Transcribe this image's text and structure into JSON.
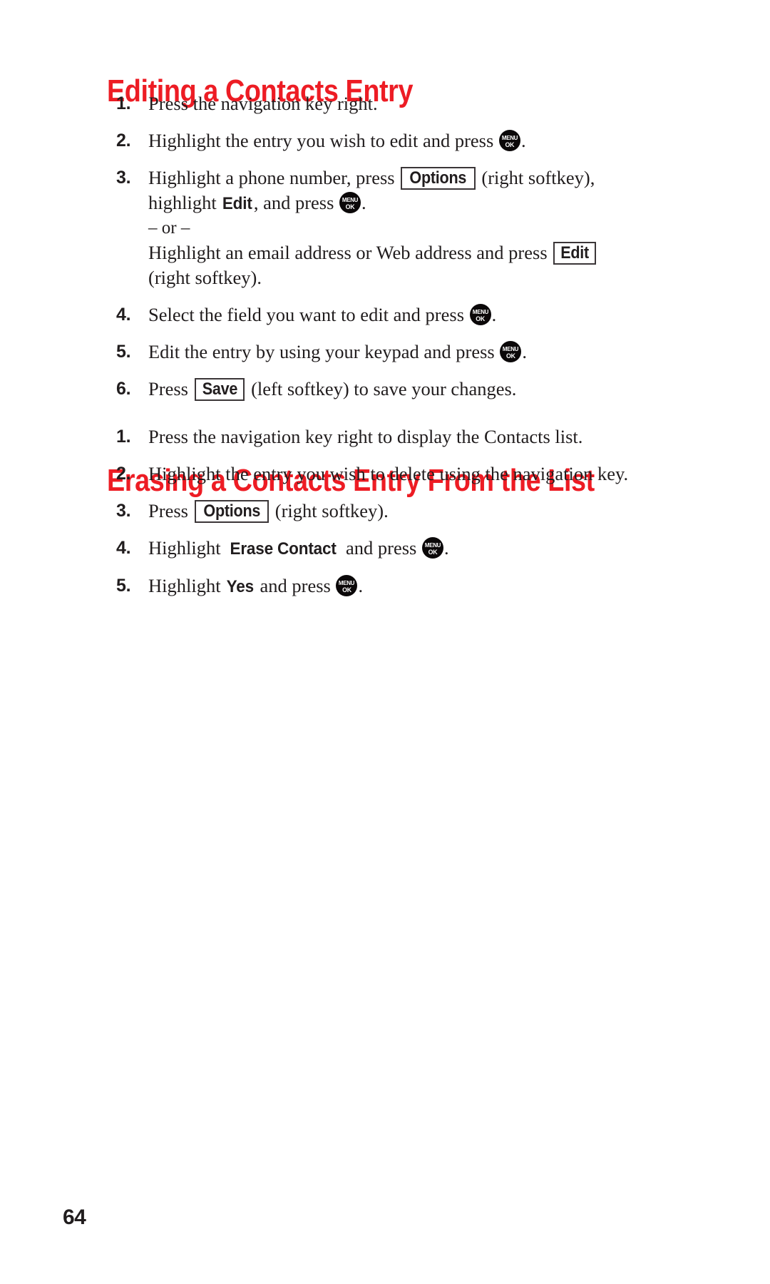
{
  "document": {
    "page_number": "64",
    "heading_color": "#ED1C24",
    "text_color": "#211D1E"
  },
  "icons": {
    "menu_ok": {
      "top": "MENU",
      "bottom": "OK",
      "name": "menu-ok-key-icon"
    }
  },
  "sections": [
    {
      "id": "editing-a-contacts-entry",
      "heading": "Editing a Contacts Entry",
      "steps": [
        {
          "number": "1.",
          "lines": [
            {
              "parts": [
                {
                  "type": "text",
                  "value": "Press the navigation key right."
                }
              ]
            }
          ]
        },
        {
          "number": "2.",
          "lines": [
            {
              "parts": [
                {
                  "type": "text",
                  "value": "Highlight the entry you wish to edit and press "
                },
                {
                  "type": "menukey"
                },
                {
                  "type": "text",
                  "value": "."
                }
              ]
            }
          ]
        },
        {
          "number": "3.",
          "lines": [
            {
              "parts": [
                {
                  "type": "text",
                  "value": "Highlight a phone number, press "
                },
                {
                  "type": "softkey",
                  "value": "Options"
                },
                {
                  "type": "text",
                  "value": " (right softkey),"
                }
              ]
            },
            {
              "parts": [
                {
                  "type": "text",
                  "value": "highlight "
                },
                {
                  "type": "term",
                  "value": "Edit"
                },
                {
                  "type": "text",
                  "value": ", and press "
                },
                {
                  "type": "menukey"
                },
                {
                  "type": "text",
                  "value": "."
                }
              ]
            },
            {
              "parts": [
                {
                  "type": "text",
                  "value": "– or –"
                }
              ]
            },
            {
              "parts": [
                {
                  "type": "text",
                  "value": "Highlight an email address or Web address and press "
                },
                {
                  "type": "softkey",
                  "value": "Edit"
                }
              ]
            },
            {
              "parts": [
                {
                  "type": "text",
                  "value": "(right softkey)."
                }
              ]
            }
          ]
        },
        {
          "number": "4.",
          "lines": [
            {
              "parts": [
                {
                  "type": "text",
                  "value": "Select the field you want to edit and press "
                },
                {
                  "type": "menukey"
                },
                {
                  "type": "text",
                  "value": "."
                }
              ]
            }
          ]
        },
        {
          "number": "5.",
          "lines": [
            {
              "parts": [
                {
                  "type": "text",
                  "value": "Edit the entry by using your keypad and press "
                },
                {
                  "type": "menukey"
                },
                {
                  "type": "text",
                  "value": "."
                }
              ]
            }
          ]
        },
        {
          "number": "6.",
          "lines": [
            {
              "parts": [
                {
                  "type": "text",
                  "value": "Press "
                },
                {
                  "type": "softkey",
                  "value": "Save"
                },
                {
                  "type": "text",
                  "value": " (left softkey) to save your changes."
                }
              ]
            }
          ]
        }
      ]
    },
    {
      "id": "erasing-a-contacts-entry-from-the-list",
      "heading": "Erasing a Contacts Entry From the List",
      "steps": [
        {
          "number": "1.",
          "lines": [
            {
              "parts": [
                {
                  "type": "text",
                  "value": "Press the navigation key right to display the Contacts list."
                }
              ]
            }
          ]
        },
        {
          "number": "2.",
          "lines": [
            {
              "parts": [
                {
                  "type": "text",
                  "value": "Highlight the entry you wish to delete using the navigation key."
                }
              ]
            }
          ]
        },
        {
          "number": "3.",
          "lines": [
            {
              "parts": [
                {
                  "type": "text",
                  "value": "Press "
                },
                {
                  "type": "softkey",
                  "value": "Options"
                },
                {
                  "type": "text",
                  "value": " (right softkey)."
                }
              ]
            }
          ]
        },
        {
          "number": "4.",
          "lines": [
            {
              "parts": [
                {
                  "type": "text",
                  "value": "Highlight "
                },
                {
                  "type": "term",
                  "value": "Erase Contact"
                },
                {
                  "type": "text",
                  "value": " and press "
                },
                {
                  "type": "menukey"
                },
                {
                  "type": "text",
                  "value": "."
                }
              ]
            }
          ]
        },
        {
          "number": "5.",
          "lines": [
            {
              "parts": [
                {
                  "type": "text",
                  "value": "Highlight "
                },
                {
                  "type": "term",
                  "value": "Yes"
                },
                {
                  "type": "text",
                  "value": " and press "
                },
                {
                  "type": "menukey"
                },
                {
                  "type": "text",
                  "value": "."
                }
              ]
            }
          ]
        }
      ]
    }
  ]
}
